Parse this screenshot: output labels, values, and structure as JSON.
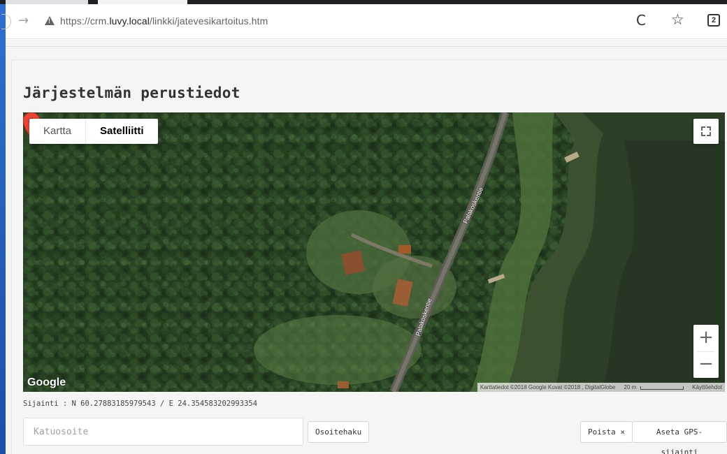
{
  "browser": {
    "url_prefix": "https://crm.",
    "url_domain": "luvy.local",
    "url_path": "/linkki/jatevesikartoitus.htm",
    "tab_count": "2",
    "forward_glyph": "→",
    "reload_glyph": "C",
    "star_glyph": "☆"
  },
  "page": {
    "title": "Järjestelmän perustiedot"
  },
  "map": {
    "type_map": "Kartta",
    "type_satellite": "Satelliitti",
    "selected_type": "Satelliitti",
    "zoom_in": "+",
    "zoom_out": "−",
    "logo": "Google",
    "attribution": "Karttatiedot ©2018 Google Kuvat ©2018 , DigitalGlobe",
    "scale": "20 m",
    "terms": "Käyttöehdot",
    "road_label": "Palakoskentie",
    "icons": [
      "fullscreen-icon",
      "map-pin-icon"
    ]
  },
  "location": {
    "text": "Sijainti : N 60.27883185979543 / E 24.354583202993354"
  },
  "form": {
    "address_placeholder": "Katuosoite",
    "address_value": "",
    "search_label": "Osoitehaku",
    "remove_label": "Poista ×",
    "gps_label": "Aseta GPS-sijainti"
  }
}
